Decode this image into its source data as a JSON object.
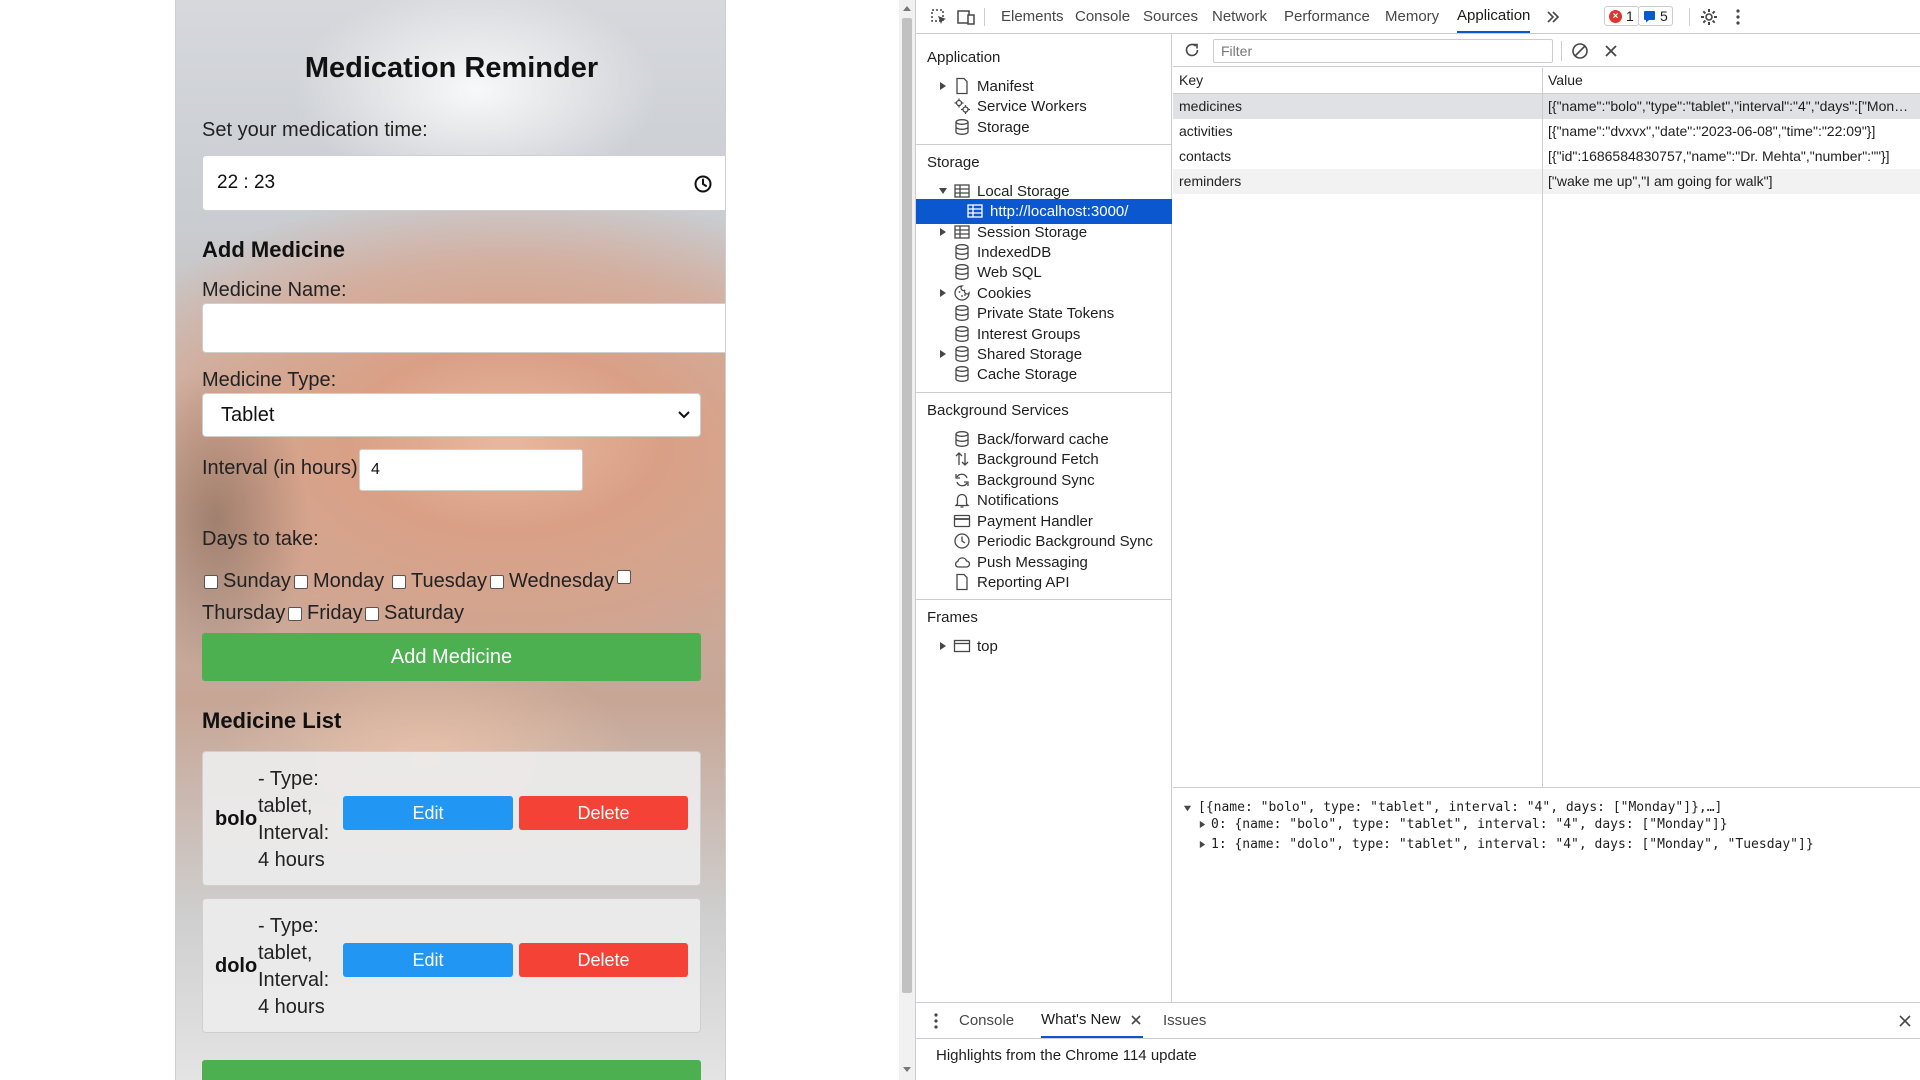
{
  "app": {
    "title": "Medication Reminder",
    "time_label": "Set your medication time:",
    "time_value": "22 : 23",
    "add_heading": "Add Medicine",
    "name_label": "Medicine Name:",
    "name_value": "",
    "type_label": "Medicine Type:",
    "type_value": "Tablet",
    "interval_label": "Interval (in hours):",
    "interval_value": "4",
    "days_label": "Days to take:",
    "days": [
      "Sunday",
      "Monday",
      "Tuesday",
      "Wednesday",
      "Thursday",
      "Friday",
      "Saturday"
    ],
    "add_button": "Add Medicine",
    "list_heading": "Medicine List",
    "medicines": [
      {
        "name": "bolo",
        "details": "- Type: tablet, Interval: 4 hours",
        "edit": "Edit",
        "delete": "Delete"
      },
      {
        "name": "dolo",
        "details": "- Type: tablet, Interval: 4 hours",
        "edit": "Edit",
        "delete": "Delete"
      }
    ],
    "colors": {
      "green": "#4caf50",
      "blue": "#2196f3",
      "red": "#f44336"
    }
  },
  "devtools": {
    "tabs": [
      "Elements",
      "Console",
      "Sources",
      "Network",
      "Performance",
      "Memory",
      "Application"
    ],
    "active_tab": "Application",
    "error_count": "1",
    "message_count": "5",
    "sidebar": {
      "application_header": "Application",
      "application_items": [
        "Manifest",
        "Service Workers",
        "Storage"
      ],
      "storage_header": "Storage",
      "storage_items": [
        "Local Storage",
        "http://localhost:3000/",
        "Session Storage",
        "IndexedDB",
        "Web SQL",
        "Cookies",
        "Private State Tokens",
        "Interest Groups",
        "Shared Storage",
        "Cache Storage"
      ],
      "background_header": "Background Services",
      "background_items": [
        "Back/forward cache",
        "Background Fetch",
        "Background Sync",
        "Notifications",
        "Payment Handler",
        "Periodic Background Sync",
        "Push Messaging",
        "Reporting API"
      ],
      "frames_header": "Frames",
      "frames_items": [
        "top"
      ]
    },
    "filter_placeholder": "Filter",
    "table": {
      "headers": [
        "Key",
        "Value"
      ],
      "rows": [
        {
          "key": "medicines",
          "value": "[{\"name\":\"bolo\",\"type\":\"tablet\",\"interval\":\"4\",\"days\":[\"Monday\"]},{\"name\":\"dolo\"}]"
        },
        {
          "key": "activities",
          "value": "[{\"name\":\"dvxvx\",\"date\":\"2023-06-08\",\"time\":\"22:09\"}]"
        },
        {
          "key": "contacts",
          "value": "[{\"id\":1686584830757,\"name\":\"Dr. Mehta\",\"number\":\"\"}]"
        },
        {
          "key": "reminders",
          "value": "[\"wake me up\",\"I am going for walk\"]"
        }
      ]
    },
    "preview": [
      "[{name: \"bolo\", type: \"tablet\", interval: \"4\", days: [\"Monday\"]},…]",
      "0: {name: \"bolo\", type: \"tablet\", interval: \"4\", days: [\"Monday\"]}",
      "1: {name: \"dolo\", type: \"tablet\", interval: \"4\", days: [\"Monday\", \"Tuesday\"]}"
    ],
    "drawer": {
      "tabs": [
        "Console",
        "What's New",
        "Issues"
      ],
      "active_tab": "What's New",
      "text": "Highlights from the Chrome 114 update"
    }
  }
}
